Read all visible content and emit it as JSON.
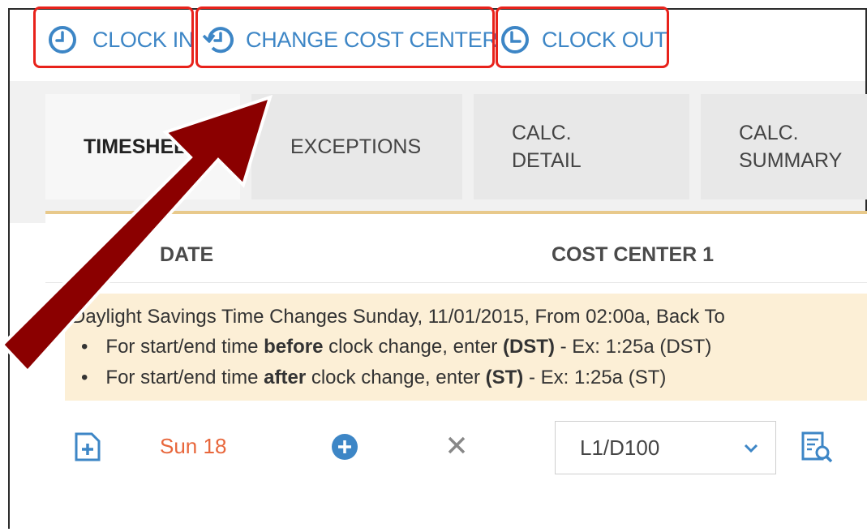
{
  "toolbar": {
    "clock_in": "CLOCK IN",
    "change_cost_center": "CHANGE COST CENTER",
    "clock_out": "CLOCK OUT"
  },
  "tabs": [
    {
      "label": "TIMESHEET",
      "active": true
    },
    {
      "label": "EXCEPTIONS",
      "active": false
    },
    {
      "label": "CALC.\nDETAIL",
      "active": false
    },
    {
      "label": "CALC.\nSUMMARY",
      "active": false
    }
  ],
  "table": {
    "headers": {
      "date": "DATE",
      "cost_center": "COST CENTER 1"
    }
  },
  "notice": {
    "title": "Daylight Savings Time Changes Sunday, 11/01/2015, From 02:00a, Back To",
    "bullets": [
      {
        "pre": "For start/end time ",
        "bold": "before",
        "mid": " clock change, enter ",
        "bold2": "(DST)",
        "post": " - Ex: 1:25a (DST)"
      },
      {
        "pre": "For start/end time ",
        "bold": "after",
        "mid": " clock change, enter ",
        "bold2": "(ST)",
        "post": " - Ex: 1:25a (ST)"
      }
    ]
  },
  "row": {
    "date": "Sun 18",
    "cost_center_value": "L1/D100"
  },
  "colors": {
    "accent": "#3d86c6",
    "highlight_box": "#e8221b",
    "arrow": "#8b0000",
    "date_red": "#e8673c",
    "notice_bg": "#fcefd6"
  }
}
